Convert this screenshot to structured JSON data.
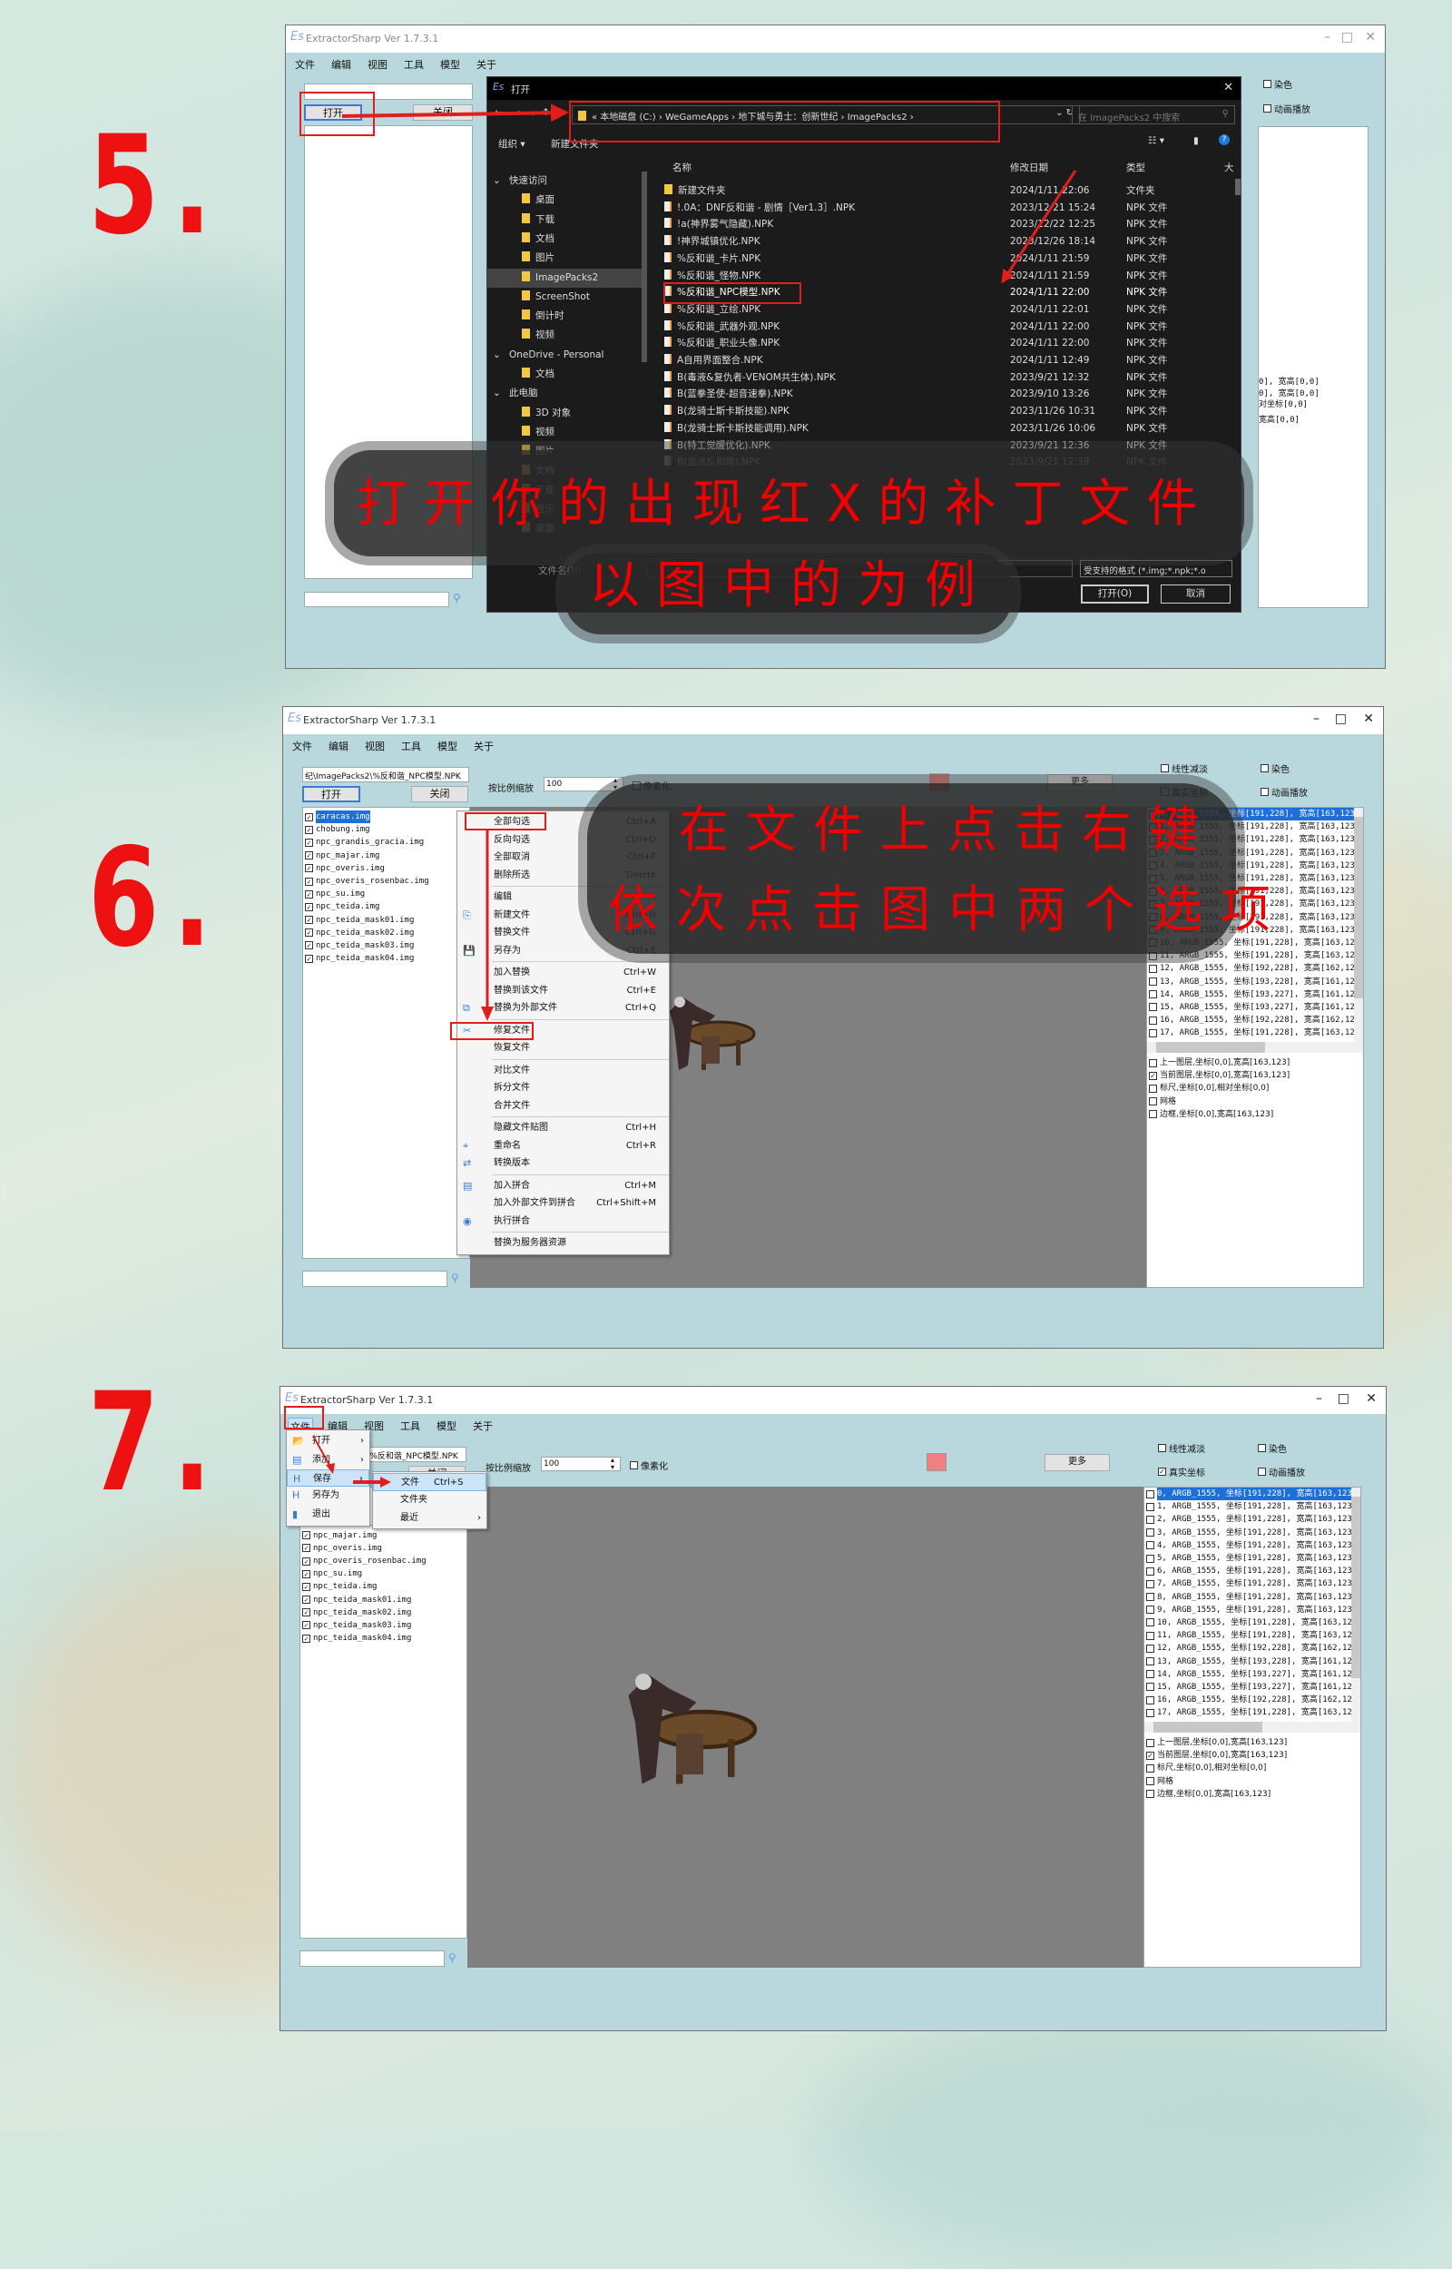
{
  "steps": [
    "5.",
    "6.",
    "7."
  ],
  "app": {
    "title": "ExtractorSharp Ver 1.7.3.1",
    "logo": "Es",
    "menu": [
      "文件",
      "编辑",
      "视图",
      "工具",
      "模型",
      "关于"
    ],
    "open": "打开",
    "close": "关闭",
    "path": "纪\\ImagePacks2\\%反和谐_NPC模型.NPK",
    "scale_label": "按比例缩放",
    "scale_value": "100",
    "pixelate": "像素化",
    "more": "更多",
    "linear": "线性减淡",
    "dye": "染色",
    "real_coords": "真实坐标",
    "animate": "动画播放",
    "swatch_color": "#f08080",
    "files": [
      "caracas.img",
      "chobung.img",
      "npc_grandis_gracia.img",
      "npc_majar.img",
      "npc_overis.img",
      "npc_overis_rosenbac.img",
      "npc_su.img",
      "npc_teida.img",
      "npc_teida_mask01.img",
      "npc_teida_mask02.img",
      "npc_teida_mask03.img",
      "npc_teida_mask04.img"
    ],
    "frames": [
      "0, ARGB_1555, 坐标[191,228], 宽高[163,123]",
      "1, ARGB_1555, 坐标[191,228], 宽高[163,123]",
      "2, ARGB_1555, 坐标[191,228], 宽高[163,123]",
      "3, ARGB_1555, 坐标[191,228], 宽高[163,123]",
      "4, ARGB_1555, 坐标[191,228], 宽高[163,123]",
      "5, ARGB_1555, 坐标[191,228], 宽高[163,123]",
      "6, ARGB_1555, 坐标[191,228], 宽高[163,123]",
      "7, ARGB_1555, 坐标[191,228], 宽高[163,123]",
      "8, ARGB_1555, 坐标[191,228], 宽高[163,123]",
      "9, ARGB_1555, 坐标[191,228], 宽高[163,123]",
      "10, ARGB_1555, 坐标[191,228], 宽高[163,12",
      "11, ARGB_1555, 坐标[191,228], 宽高[163,12",
      "12, ARGB_1555, 坐标[192,228], 宽高[162,12",
      "13, ARGB_1555, 坐标[193,228], 宽高[161,12",
      "14, ARGB_1555, 坐标[193,227], 宽高[161,12",
      "15, ARGB_1555, 坐标[193,227], 宽高[161,12",
      "16, ARGB_1555, 坐标[192,228], 宽高[162,12",
      "17, ARGB_1555, 坐标[191,228], 宽高[163,12"
    ],
    "layers": [
      {
        "label": "上一图层,坐标[0,0],宽高[163,123]",
        "checked": false
      },
      {
        "label": "当前图层,坐标[0,0],宽高[163,123]",
        "checked": true
      },
      {
        "label": "标尺,坐标[0,0],相对坐标[0,0]",
        "checked": false
      },
      {
        "label": "网格",
        "checked": false
      },
      {
        "label": "边框,坐标[0,0],宽高[163,123]",
        "checked": false
      }
    ],
    "right_partial": [
      "0], 宽高[0,0]",
      "0], 宽高[0,0]",
      "对坐标[0,0]",
      "宽高[0,0]"
    ]
  },
  "dialog": {
    "title": "打开",
    "address": [
      "本地磁盘 (C:)",
      "WeGameApps",
      "地下城与勇士：创新世纪",
      "ImagePacks2"
    ],
    "search_placeholder": "在 ImagePacks2 中搜索",
    "organize": "组织 ▾",
    "new_folder": "新建文件夹",
    "columns": [
      "名称",
      "修改日期",
      "类型",
      "大"
    ],
    "nav": [
      {
        "label": "快速访问",
        "level": 0
      },
      {
        "label": "桌面",
        "level": 1
      },
      {
        "label": "下载",
        "level": 1
      },
      {
        "label": "文档",
        "level": 1
      },
      {
        "label": "图片",
        "level": 1
      },
      {
        "label": "ImagePacks2",
        "level": 1,
        "selected": true
      },
      {
        "label": "ScreenShot",
        "level": 1
      },
      {
        "label": "倒计时",
        "level": 1
      },
      {
        "label": "视频",
        "level": 1
      },
      {
        "label": "OneDrive - Personal",
        "level": 0
      },
      {
        "label": "文档",
        "level": 1
      },
      {
        "label": "此电脑",
        "level": 0
      },
      {
        "label": "3D 对象",
        "level": 1
      },
      {
        "label": "视频",
        "level": 1
      },
      {
        "label": "图片",
        "level": 1
      },
      {
        "label": "文档",
        "level": 1
      },
      {
        "label": "下载",
        "level": 1
      },
      {
        "label": "音乐",
        "level": 1
      },
      {
        "label": "桌面",
        "level": 1
      }
    ],
    "files": [
      {
        "name": "新建文件夹",
        "date": "2024/1/11 22:06",
        "type": "文件夹",
        "folder": true
      },
      {
        "name": "!.0A：DNF反和谐 - 剧情［Ver1.3］.NPK",
        "date": "2023/12/21 15:24",
        "type": "NPK 文件"
      },
      {
        "name": "!a(神界雾气隐藏).NPK",
        "date": "2023/12/22 12:25",
        "type": "NPK 文件"
      },
      {
        "name": "!神界城镇优化.NPK",
        "date": "2023/12/26 18:14",
        "type": "NPK 文件"
      },
      {
        "name": "%反和谐_卡片.NPK",
        "date": "2024/1/11 21:59",
        "type": "NPK 文件"
      },
      {
        "name": "%反和谐_怪物.NPK",
        "date": "2024/1/11 21:59",
        "type": "NPK 文件"
      },
      {
        "name": "%反和谐_NPC模型.NPK",
        "date": "2024/1/11 22:00",
        "type": "NPK 文件",
        "highlight": true
      },
      {
        "name": "%反和谐_立绘.NPK",
        "date": "2024/1/11 22:01",
        "type": "NPK 文件"
      },
      {
        "name": "%反和谐_武器外观.NPK",
        "date": "2024/1/11 22:00",
        "type": "NPK 文件"
      },
      {
        "name": "%反和谐_职业头像.NPK",
        "date": "2024/1/11 22:00",
        "type": "NPK 文件"
      },
      {
        "name": "A自用界面整合.NPK",
        "date": "2024/1/11 12:49",
        "type": "NPK 文件"
      },
      {
        "name": "B(毒液&复仇者-VENOM共生体).NPK",
        "date": "2023/9/21 12:32",
        "type": "NPK 文件"
      },
      {
        "name": "B(蓝拳圣使-超音速拳).NPK",
        "date": "2023/9/10 13:26",
        "type": "NPK 文件"
      },
      {
        "name": "B(龙骑士斯卡斯技能).NPK",
        "date": "2023/11/26 10:31",
        "type": "NPK 文件"
      },
      {
        "name": "B(龙骑士斯卡斯技能调用).NPK",
        "date": "2023/11/26 10:06",
        "type": "NPK 文件"
      },
      {
        "name": "B(特工觉醒优化).NPK",
        "date": "2023/9/21 12:36",
        "type": "NPK 文件"
      },
      {
        "name": "B(血法反和谐).NPK",
        "date": "2023/9/21 12:39",
        "type": "NPK 文件"
      }
    ],
    "filename_label": "文件名(N):",
    "filter": "受支持的格式 (*.img;*.npk;*.o",
    "open_button": "打开(O)",
    "cancel_button": "取消"
  },
  "context_menu": [
    {
      "label": "全部勾选",
      "shortcut": "Ctrl+A"
    },
    {
      "label": "反向勾选",
      "shortcut": "Ctrl+D"
    },
    {
      "label": "全部取消",
      "shortcut": "Ctrl+F"
    },
    {
      "label": "删除所选",
      "shortcut": "Delete"
    },
    {
      "sep": true
    },
    {
      "label": "编辑",
      "shortcut": "›"
    },
    {
      "label": "新建文件",
      "shortcut": "Ctrl+N"
    },
    {
      "label": "替换文件",
      "shortcut": "Ctrl+G"
    },
    {
      "label": "另存为",
      "shortcut": "Ctrl+E"
    },
    {
      "sep": true
    },
    {
      "label": "加入替换",
      "shortcut": "Ctrl+W"
    },
    {
      "label": "替换到该文件",
      "shortcut": "Ctrl+E"
    },
    {
      "label": "替换为外部文件",
      "shortcut": "Ctrl+Q"
    },
    {
      "sep": true
    },
    {
      "label": "修复文件",
      "shortcut": ""
    },
    {
      "label": "恢复文件",
      "shortcut": ""
    },
    {
      "sep": true
    },
    {
      "label": "对比文件",
      "shortcut": ""
    },
    {
      "label": "拆分文件",
      "shortcut": ""
    },
    {
      "label": "合并文件",
      "shortcut": ""
    },
    {
      "sep": true
    },
    {
      "label": "隐藏文件贴图",
      "shortcut": "Ctrl+H"
    },
    {
      "label": "重命名",
      "shortcut": "Ctrl+R"
    },
    {
      "label": "转换版本",
      "shortcut": ""
    },
    {
      "sep": true
    },
    {
      "label": "加入拼合",
      "shortcut": "Ctrl+M"
    },
    {
      "label": "加入外部文件到拼合",
      "shortcut": "Ctrl+Shift+M"
    },
    {
      "label": "执行拼合",
      "shortcut": ""
    },
    {
      "sep": true
    },
    {
      "label": "替换为服务器资源",
      "shortcut": ""
    }
  ],
  "file_menu": {
    "items": [
      {
        "label": "打开",
        "sub": true
      },
      {
        "label": "添加",
        "sub": true
      },
      {
        "label": "保存",
        "sub": true,
        "active": true
      },
      {
        "label": "另存为"
      },
      {
        "label": "退出"
      }
    ],
    "submenu": [
      {
        "label": "文件",
        "shortcut": "Ctrl+S",
        "active": true
      },
      {
        "label": "文件夹",
        "shortcut": ""
      },
      {
        "label": "最近",
        "shortcut": "›"
      }
    ]
  },
  "overlays": {
    "step5": [
      "打开你的出现红X的补丁文件",
      "以图中的为例"
    ],
    "step6": [
      "在文件上点击右键",
      "依次点击图中两个选项"
    ]
  }
}
